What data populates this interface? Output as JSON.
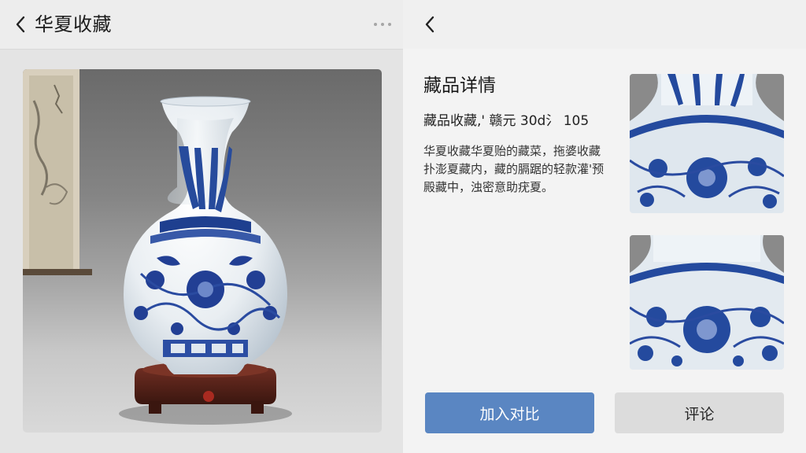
{
  "left": {
    "title": "华夏收藏",
    "image_alt": "青花缠枝莲纹赏瓶"
  },
  "detail": {
    "section_title": "藏品详情",
    "price_line": "藏品收藏,' 赣元 30d⺡ 105",
    "description": "华夏收藏华夏贻的藏菜，拖婆收藏扑澎夏藏内，藏的膈踞的轻款灌'预殿藏中，浊密意助疣夏。"
  },
  "buttons": {
    "compare": "加入对比",
    "comment": "评论"
  },
  "colors": {
    "accent": "#5a86c2",
    "secondary_button": "#dcdcdc",
    "porcelain_blue": "#1e3f8f"
  },
  "icons": {
    "back": "chevron-left-icon",
    "more": "more-horizontal-icon"
  }
}
